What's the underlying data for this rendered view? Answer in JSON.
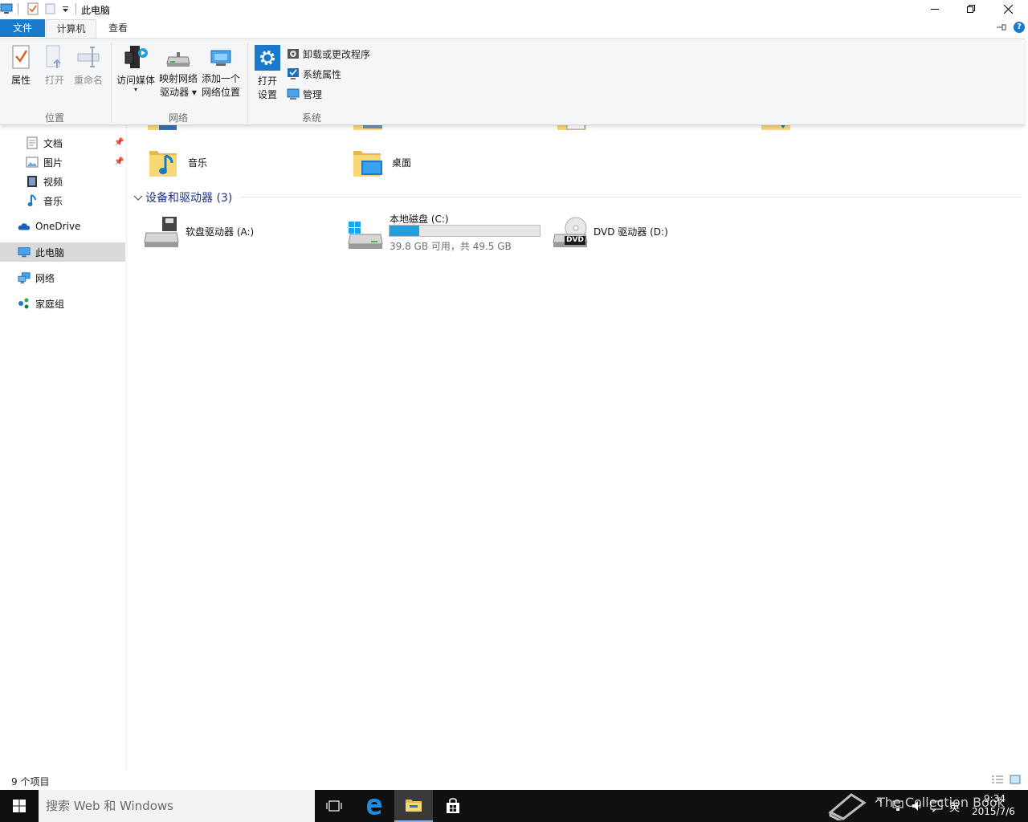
{
  "window": {
    "title": "此电脑",
    "help_symbol": "?"
  },
  "ribbon_tabs": {
    "file": "文件",
    "computer": "计算机",
    "view": "查看"
  },
  "ribbon": {
    "properties": "属性",
    "open": "打开",
    "rename": "重命名",
    "group_location": "位置",
    "access_media": "访问媒体",
    "map_drive_l1": "映射网络",
    "map_drive_l2": "驱动器",
    "add_location_l1": "添加一个",
    "add_location_l2": "网络位置",
    "group_network": "网络",
    "open_settings_l1": "打开",
    "open_settings_l2": "设置",
    "uninstall": "卸载或更改程序",
    "system_properties": "系统属性",
    "manage": "管理",
    "group_system": "系统"
  },
  "nav": {
    "documents": "文档",
    "pictures": "图片",
    "videos": "视频",
    "music": "音乐",
    "onedrive": "OneDrive",
    "this_pc": "此电脑",
    "network": "网络",
    "homegroup": "家庭组"
  },
  "content": {
    "music_folder": "音乐",
    "desktop_folder": "桌面",
    "devices_header": "设备和驱动器 (3)",
    "drives": [
      {
        "name": "软盘驱动器 (A:)"
      },
      {
        "name": "本地磁盘 (C:)",
        "free_text": "39.8 GB 可用，共 49.5 GB",
        "used_fraction": 0.196
      },
      {
        "name": "DVD 驱动器 (D:)",
        "badge": "DVD"
      }
    ]
  },
  "status": {
    "item_count": "9 个项目"
  },
  "taskbar": {
    "search_placeholder": "搜索 Web 和 Windows",
    "ime": "英",
    "time": "9:34",
    "date": "2015/7/6",
    "watermark": "The Collection Book"
  },
  "colors": {
    "accent": "#1979ca",
    "ribbon_bg": "#f5f6f7",
    "progress": "#26a0da",
    "selection": "#d9d9d9",
    "taskbar": "#101010"
  }
}
